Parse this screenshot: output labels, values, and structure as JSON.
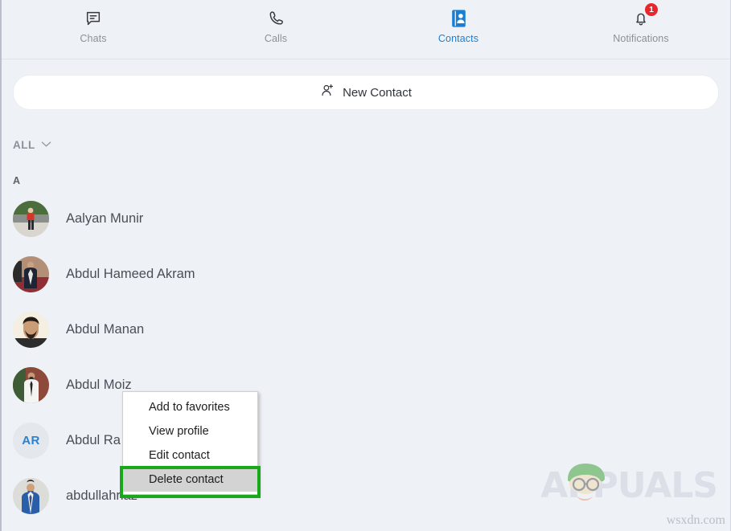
{
  "window": {
    "background_color": "#eef1f6"
  },
  "topnav": {
    "items": [
      {
        "label": "Chats",
        "icon": "chat-bubble-icon",
        "active": false,
        "badge": null
      },
      {
        "label": "Calls",
        "icon": "phone-icon",
        "active": false,
        "badge": null
      },
      {
        "label": "Contacts",
        "icon": "contact-book-icon",
        "active": true,
        "badge": null
      },
      {
        "label": "Notifications",
        "icon": "bell-icon",
        "active": false,
        "badge": "1"
      }
    ],
    "active_color": "#1a7fd4",
    "inactive_color": "#8b9099",
    "badge_color": "#e8262c"
  },
  "new_contact": {
    "label": "New Contact",
    "icon": "person-plus-icon"
  },
  "filter": {
    "label": "ALL",
    "icon": "chevron-down-icon"
  },
  "section": {
    "letter": "A"
  },
  "contacts": [
    {
      "name": "Aalyan Munir",
      "avatar_type": "photo",
      "initials": ""
    },
    {
      "name": "Abdul Hameed Akram",
      "avatar_type": "photo",
      "initials": ""
    },
    {
      "name": "Abdul Manan",
      "avatar_type": "photo",
      "initials": ""
    },
    {
      "name": "Abdul Moiz",
      "avatar_type": "photo",
      "initials": ""
    },
    {
      "name": "Abdul Ra",
      "avatar_type": "initials",
      "initials": "AR"
    },
    {
      "name": "abdullahriaz",
      "avatar_type": "photo",
      "initials": ""
    }
  ],
  "context_menu": {
    "items": [
      {
        "label": "Add to favorites",
        "selected": false
      },
      {
        "label": "View profile",
        "selected": false
      },
      {
        "label": "Edit contact",
        "selected": false
      },
      {
        "label": "Delete contact",
        "selected": true
      }
    ],
    "highlight_color": "#19a819"
  },
  "watermark": {
    "brand": "APPUALS",
    "domain": "wsxdn.com"
  }
}
